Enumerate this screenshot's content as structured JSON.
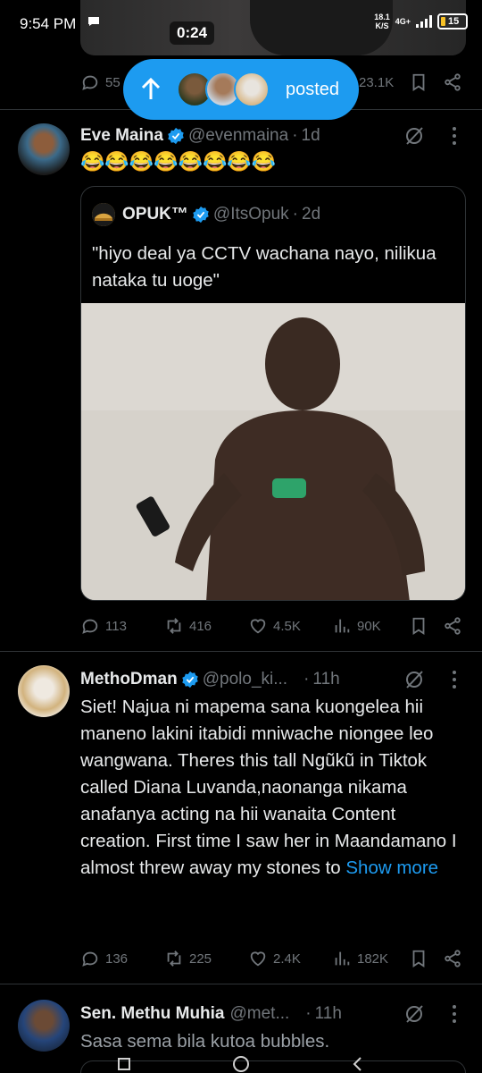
{
  "status_bar": {
    "time": "9:54 PM",
    "net_speed": "18.1",
    "net_unit": "K/S",
    "network": "4G+",
    "battery": "15"
  },
  "top_tweet": {
    "video_time": "0:24",
    "replies": "55",
    "views": "23.1K"
  },
  "posted_pill": {
    "label": "posted"
  },
  "tweets": [
    {
      "name": "Eve Maina",
      "handle": "@evenmaina",
      "time": "1d",
      "text": "😂😂😂😂😂😂😂😂",
      "quote": {
        "name": "OPUK™",
        "handle": "@ItsOpuk",
        "time": "2d",
        "text": "\"hiyo deal ya CCTV wachana nayo, nilikua nataka tu uoge\""
      },
      "replies": "113",
      "retweets": "416",
      "likes": "4.5K",
      "views": "90K"
    },
    {
      "name": "MethoDman",
      "handle": "@polo_ki...",
      "time": "11h",
      "text": "Siet! Najua ni mapema sana kuongelea hii maneno lakini itabidi mniwache niongee leo wangwana. Theres this tall Ngũkũ in Tiktok called Diana Luvanda,naonanga nikama anafanya acting na hii wanaita Content creation. First time I saw her in Maandamano I almost threw away my stones to ",
      "show_more": "Show more",
      "replies": "136",
      "retweets": "225",
      "likes": "2.4K",
      "views": "182K"
    },
    {
      "name": "Sen. Methu Muhia",
      "handle": "@met...",
      "time": "11h",
      "text": "Sasa sema bila kutoa bubbles."
    }
  ],
  "colors": {
    "accent": "#1d9bf0",
    "muted": "#71767b",
    "background": "#000000"
  }
}
